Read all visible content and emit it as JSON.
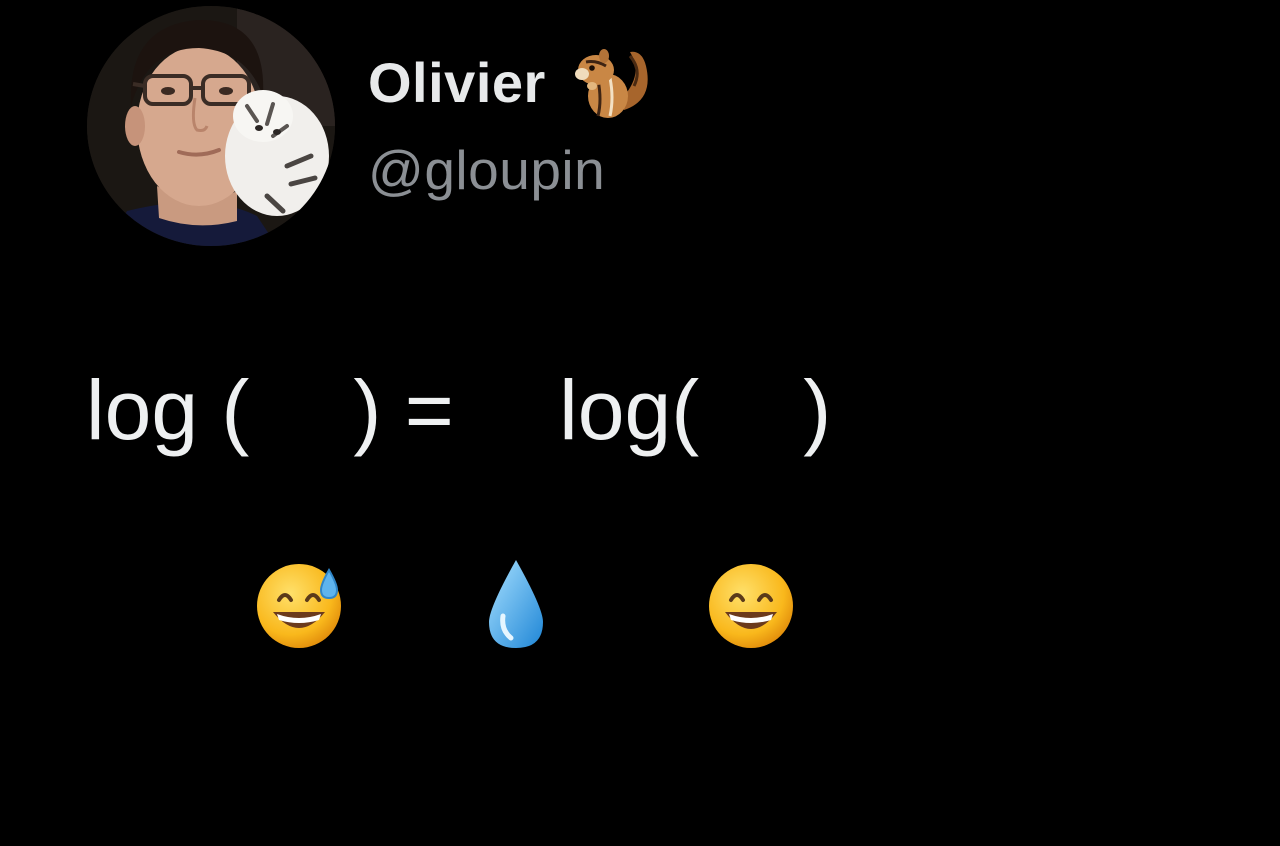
{
  "author": {
    "display_name": "Olivier",
    "name_emoji": "chipmunk-emoji",
    "handle": "@gloupin",
    "avatar": "profile-photo"
  },
  "tweet": {
    "text_parts": {
      "p1": "log (",
      "e1": "grinning-face-with-sweat-emoji",
      "p2": ") = ",
      "e2": "droplet-emoji",
      "p3": "log(",
      "e3": "beaming-face-with-smiling-eyes-emoji",
      "p4": ")"
    }
  },
  "colors": {
    "background": "#000000",
    "name": "#e7e9ea",
    "handle": "#8b8f94",
    "text": "#eef0f1"
  }
}
